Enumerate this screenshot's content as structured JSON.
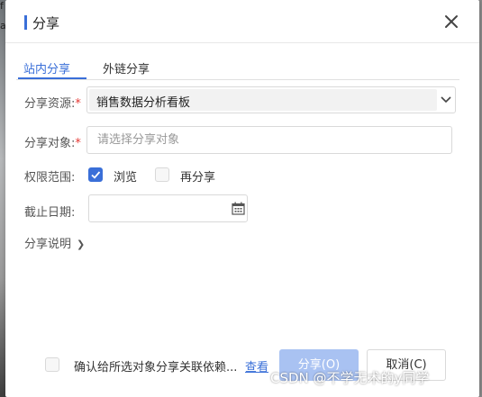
{
  "dialog": {
    "title": "分享"
  },
  "tabs": [
    {
      "label": "站内分享",
      "active": true
    },
    {
      "label": "外链分享",
      "active": false
    }
  ],
  "form": {
    "resource": {
      "label": "分享资源:",
      "required_mark": "*",
      "value": "销售数据分析看板"
    },
    "target": {
      "label": "分享对象:",
      "required_mark": "*",
      "placeholder": "请选择分享对象",
      "value": ""
    },
    "permission": {
      "label": "权限范围:",
      "options": [
        {
          "label": "浏览",
          "checked": true
        },
        {
          "label": "再分享",
          "checked": false
        }
      ]
    },
    "deadline": {
      "label": "截止日期:",
      "value": ""
    },
    "description_toggle": {
      "label": "分享说明"
    }
  },
  "footer": {
    "confirm": {
      "text": "确认给所选对象分享关联依赖...",
      "checked": false
    },
    "view_link": "查看",
    "share_button": "分享(O)",
    "cancel_button": "取消(C)"
  },
  "watermark": "CSDN @不学无术的y同学",
  "colors": {
    "accent": "#3a6fd8",
    "required": "#e53935",
    "primary_disabled": "#a9c2f2"
  }
}
